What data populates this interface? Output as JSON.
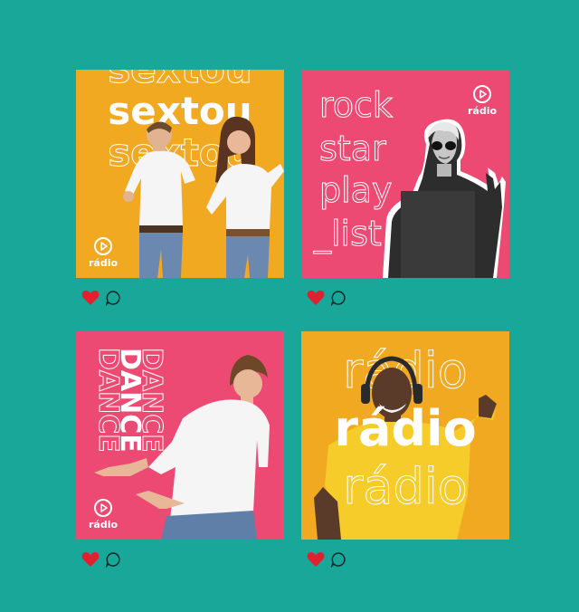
{
  "posts": [
    {
      "big_word": "sextou",
      "logo_label": "rádio"
    },
    {
      "lines": [
        "rock",
        "star",
        "play",
        "_list"
      ],
      "logo_label": "rádio"
    },
    {
      "big_word": "DANCE",
      "logo_label": "rádio"
    },
    {
      "big_word": "rádio"
    }
  ],
  "colors": {
    "background": "#19a79a",
    "yellow": "#f2a922",
    "pink": "#ec4a72",
    "heart": "#e0202f"
  },
  "icons": [
    "heart-icon",
    "comment-icon",
    "play-icon"
  ]
}
